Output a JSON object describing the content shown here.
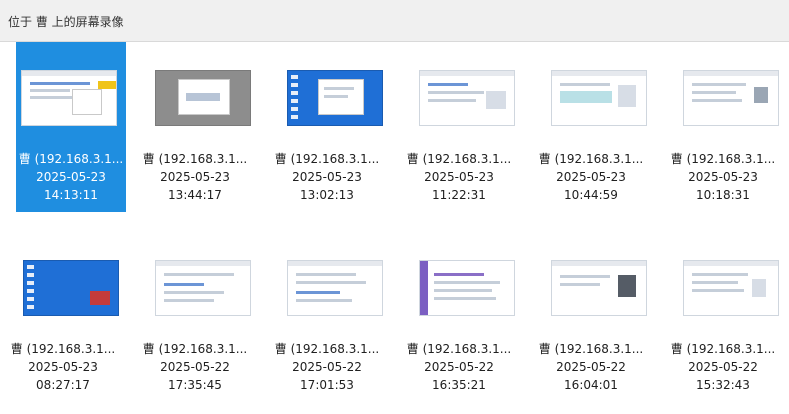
{
  "location": {
    "text": "位于 曹 上的屏幕录像"
  },
  "items": [
    {
      "name": "曹 (192.168.3.1...",
      "date": "2025-05-23",
      "time": "14:13:11",
      "selected": true
    },
    {
      "name": "曹 (192.168.3.1...",
      "date": "2025-05-23",
      "time": "13:44:17"
    },
    {
      "name": "曹 (192.168.3.1...",
      "date": "2025-05-23",
      "time": "13:02:13"
    },
    {
      "name": "曹 (192.168.3.1...",
      "date": "2025-05-23",
      "time": "11:22:31"
    },
    {
      "name": "曹 (192.168.3.1...",
      "date": "2025-05-23",
      "time": "10:44:59"
    },
    {
      "name": "曹 (192.168.3.1...",
      "date": "2025-05-23",
      "time": "10:18:31"
    },
    {
      "name": "曹 (192.168.3.1...",
      "date": "2025-05-23",
      "time": "08:27:17"
    },
    {
      "name": "曹 (192.168.3.1...",
      "date": "2025-05-22",
      "time": "17:35:45"
    },
    {
      "name": "曹 (192.168.3.1...",
      "date": "2025-05-22",
      "time": "17:01:53"
    },
    {
      "name": "曹 (192.168.3.1...",
      "date": "2025-05-22",
      "time": "16:35:21"
    },
    {
      "name": "曹 (192.168.3.1...",
      "date": "2025-05-22",
      "time": "16:04:01"
    },
    {
      "name": "曹 (192.168.3.1...",
      "date": "2025-05-22",
      "time": "15:32:43"
    }
  ],
  "colors": {
    "selection": "#1f8ee0",
    "desktop_blue": "#1f6fd6",
    "text": "#202020"
  }
}
